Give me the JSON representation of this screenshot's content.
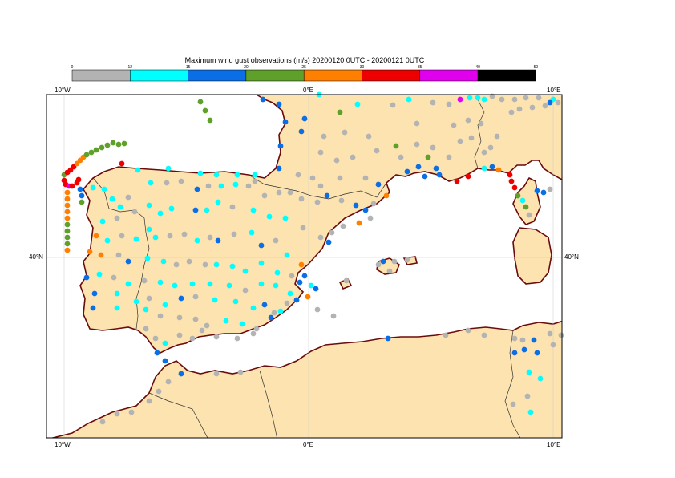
{
  "title": "Maximum wind gust observations (m/s) 20200120 0UTC - 20200121 0UTC",
  "colorbar": {
    "ticks": [
      "0",
      "12",
      "15",
      "20",
      "25",
      "30",
      "35",
      "40",
      "50"
    ],
    "colors": [
      "#b3b3b3",
      "#00ffff",
      "#0a6ee6",
      "#5fa02a",
      "#ff8000",
      "#ee0000",
      "#e000ee",
      "#000000"
    ]
  },
  "axes": {
    "top": [
      "10°W",
      "0°E",
      "10°E"
    ],
    "bottom": [
      "10°W",
      "0°E",
      "10°E"
    ],
    "left": [
      "40°N"
    ],
    "right": [
      "40°N"
    ]
  },
  "colors": {
    "land": "#fce3b0",
    "sea": "#ffffff",
    "coast": "#6b0b0b",
    "border": "#333333",
    "grid": "#cccccc"
  }
}
